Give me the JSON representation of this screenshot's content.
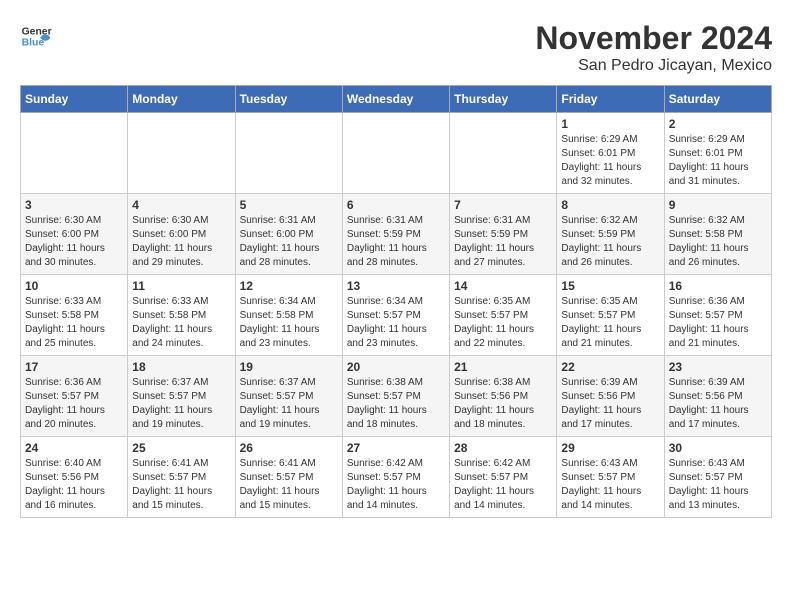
{
  "header": {
    "month_title": "November 2024",
    "location": "San Pedro Jicayan, Mexico",
    "logo_general": "General",
    "logo_blue": "Blue"
  },
  "days_of_week": [
    "Sunday",
    "Monday",
    "Tuesday",
    "Wednesday",
    "Thursday",
    "Friday",
    "Saturday"
  ],
  "weeks": [
    {
      "days": [
        {
          "num": "",
          "info": ""
        },
        {
          "num": "",
          "info": ""
        },
        {
          "num": "",
          "info": ""
        },
        {
          "num": "",
          "info": ""
        },
        {
          "num": "",
          "info": ""
        },
        {
          "num": "1",
          "info": "Sunrise: 6:29 AM\nSunset: 6:01 PM\nDaylight: 11 hours and 32 minutes."
        },
        {
          "num": "2",
          "info": "Sunrise: 6:29 AM\nSunset: 6:01 PM\nDaylight: 11 hours and 31 minutes."
        }
      ]
    },
    {
      "days": [
        {
          "num": "3",
          "info": "Sunrise: 6:30 AM\nSunset: 6:00 PM\nDaylight: 11 hours and 30 minutes."
        },
        {
          "num": "4",
          "info": "Sunrise: 6:30 AM\nSunset: 6:00 PM\nDaylight: 11 hours and 29 minutes."
        },
        {
          "num": "5",
          "info": "Sunrise: 6:31 AM\nSunset: 6:00 PM\nDaylight: 11 hours and 28 minutes."
        },
        {
          "num": "6",
          "info": "Sunrise: 6:31 AM\nSunset: 5:59 PM\nDaylight: 11 hours and 28 minutes."
        },
        {
          "num": "7",
          "info": "Sunrise: 6:31 AM\nSunset: 5:59 PM\nDaylight: 11 hours and 27 minutes."
        },
        {
          "num": "8",
          "info": "Sunrise: 6:32 AM\nSunset: 5:59 PM\nDaylight: 11 hours and 26 minutes."
        },
        {
          "num": "9",
          "info": "Sunrise: 6:32 AM\nSunset: 5:58 PM\nDaylight: 11 hours and 26 minutes."
        }
      ]
    },
    {
      "days": [
        {
          "num": "10",
          "info": "Sunrise: 6:33 AM\nSunset: 5:58 PM\nDaylight: 11 hours and 25 minutes."
        },
        {
          "num": "11",
          "info": "Sunrise: 6:33 AM\nSunset: 5:58 PM\nDaylight: 11 hours and 24 minutes."
        },
        {
          "num": "12",
          "info": "Sunrise: 6:34 AM\nSunset: 5:58 PM\nDaylight: 11 hours and 23 minutes."
        },
        {
          "num": "13",
          "info": "Sunrise: 6:34 AM\nSunset: 5:57 PM\nDaylight: 11 hours and 23 minutes."
        },
        {
          "num": "14",
          "info": "Sunrise: 6:35 AM\nSunset: 5:57 PM\nDaylight: 11 hours and 22 minutes."
        },
        {
          "num": "15",
          "info": "Sunrise: 6:35 AM\nSunset: 5:57 PM\nDaylight: 11 hours and 21 minutes."
        },
        {
          "num": "16",
          "info": "Sunrise: 6:36 AM\nSunset: 5:57 PM\nDaylight: 11 hours and 21 minutes."
        }
      ]
    },
    {
      "days": [
        {
          "num": "17",
          "info": "Sunrise: 6:36 AM\nSunset: 5:57 PM\nDaylight: 11 hours and 20 minutes."
        },
        {
          "num": "18",
          "info": "Sunrise: 6:37 AM\nSunset: 5:57 PM\nDaylight: 11 hours and 19 minutes."
        },
        {
          "num": "19",
          "info": "Sunrise: 6:37 AM\nSunset: 5:57 PM\nDaylight: 11 hours and 19 minutes."
        },
        {
          "num": "20",
          "info": "Sunrise: 6:38 AM\nSunset: 5:57 PM\nDaylight: 11 hours and 18 minutes."
        },
        {
          "num": "21",
          "info": "Sunrise: 6:38 AM\nSunset: 5:56 PM\nDaylight: 11 hours and 18 minutes."
        },
        {
          "num": "22",
          "info": "Sunrise: 6:39 AM\nSunset: 5:56 PM\nDaylight: 11 hours and 17 minutes."
        },
        {
          "num": "23",
          "info": "Sunrise: 6:39 AM\nSunset: 5:56 PM\nDaylight: 11 hours and 17 minutes."
        }
      ]
    },
    {
      "days": [
        {
          "num": "24",
          "info": "Sunrise: 6:40 AM\nSunset: 5:56 PM\nDaylight: 11 hours and 16 minutes."
        },
        {
          "num": "25",
          "info": "Sunrise: 6:41 AM\nSunset: 5:57 PM\nDaylight: 11 hours and 15 minutes."
        },
        {
          "num": "26",
          "info": "Sunrise: 6:41 AM\nSunset: 5:57 PM\nDaylight: 11 hours and 15 minutes."
        },
        {
          "num": "27",
          "info": "Sunrise: 6:42 AM\nSunset: 5:57 PM\nDaylight: 11 hours and 14 minutes."
        },
        {
          "num": "28",
          "info": "Sunrise: 6:42 AM\nSunset: 5:57 PM\nDaylight: 11 hours and 14 minutes."
        },
        {
          "num": "29",
          "info": "Sunrise: 6:43 AM\nSunset: 5:57 PM\nDaylight: 11 hours and 14 minutes."
        },
        {
          "num": "30",
          "info": "Sunrise: 6:43 AM\nSunset: 5:57 PM\nDaylight: 11 hours and 13 minutes."
        }
      ]
    }
  ]
}
